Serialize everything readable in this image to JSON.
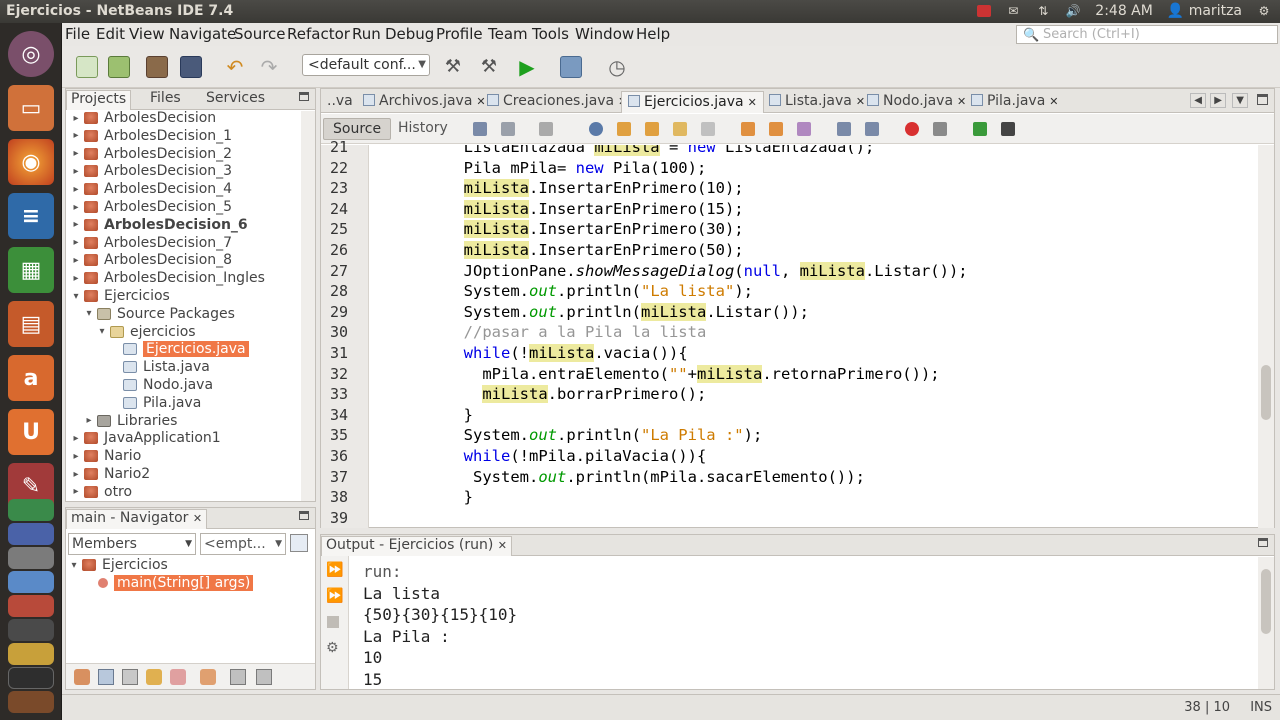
{
  "window": {
    "title": "Ejercicios - NetBeans IDE 7.4"
  },
  "tray": {
    "time": "2:48 AM",
    "user": "maritza"
  },
  "menu": [
    "File",
    "Edit",
    "View",
    "Navigate",
    "Source",
    "Refactor",
    "Run",
    "Debug",
    "Profile",
    "Team",
    "Tools",
    "Window",
    "Help"
  ],
  "search": {
    "placeholder": "Search (Ctrl+I)"
  },
  "toolbar": {
    "config": "<default conf..."
  },
  "projects_panel": {
    "tabs": [
      "Projects",
      "Files",
      "Services"
    ],
    "items": [
      {
        "label": "ArbolesDecision",
        "indent": 0,
        "type": "project",
        "tw": "▸"
      },
      {
        "label": "ArbolesDecision_1",
        "indent": 0,
        "type": "project",
        "tw": "▸"
      },
      {
        "label": "ArbolesDecision_2",
        "indent": 0,
        "type": "project",
        "tw": "▸"
      },
      {
        "label": "ArbolesDecision_3",
        "indent": 0,
        "type": "project",
        "tw": "▸"
      },
      {
        "label": "ArbolesDecision_4",
        "indent": 0,
        "type": "project",
        "tw": "▸"
      },
      {
        "label": "ArbolesDecision_5",
        "indent": 0,
        "type": "project",
        "tw": "▸"
      },
      {
        "label": "ArbolesDecision_6",
        "indent": 0,
        "type": "project",
        "tw": "▸",
        "bold": true
      },
      {
        "label": "ArbolesDecision_7",
        "indent": 0,
        "type": "project",
        "tw": "▸"
      },
      {
        "label": "ArbolesDecision_8",
        "indent": 0,
        "type": "project",
        "tw": "▸"
      },
      {
        "label": "ArbolesDecision_Ingles",
        "indent": 0,
        "type": "project",
        "tw": "▸"
      },
      {
        "label": "Ejercicios",
        "indent": 0,
        "type": "project",
        "tw": "▾"
      },
      {
        "label": "Source Packages",
        "indent": 1,
        "type": "src",
        "tw": "▾"
      },
      {
        "label": "ejercicios",
        "indent": 2,
        "type": "pkg",
        "tw": "▾"
      },
      {
        "label": "Ejercicios.java",
        "indent": 3,
        "type": "java",
        "tw": "",
        "selected": true
      },
      {
        "label": "Lista.java",
        "indent": 3,
        "type": "java",
        "tw": ""
      },
      {
        "label": "Nodo.java",
        "indent": 3,
        "type": "java",
        "tw": ""
      },
      {
        "label": "Pila.java",
        "indent": 3,
        "type": "java",
        "tw": ""
      },
      {
        "label": "Libraries",
        "indent": 1,
        "type": "lib",
        "tw": "▸"
      },
      {
        "label": "JavaApplication1",
        "indent": 0,
        "type": "project",
        "tw": "▸"
      },
      {
        "label": "Nario",
        "indent": 0,
        "type": "project",
        "tw": "▸"
      },
      {
        "label": "Nario2",
        "indent": 0,
        "type": "project",
        "tw": "▸"
      },
      {
        "label": "otro",
        "indent": 0,
        "type": "project",
        "tw": "▸"
      }
    ]
  },
  "navigator": {
    "title": "main - Navigator",
    "members_label": "Members",
    "filter_label": "<empt...",
    "class_name": "Ejercicios",
    "method": "main(String[] args)"
  },
  "editor": {
    "tabs": [
      {
        "label": "..va"
      },
      {
        "label": "Archivos.java"
      },
      {
        "label": "Creaciones.java"
      },
      {
        "label": "Ejercicios.java",
        "active": true
      },
      {
        "label": "Lista.java"
      },
      {
        "label": "Nodo.java"
      },
      {
        "label": "Pila.java"
      }
    ],
    "source_label": "Source",
    "history_label": "History",
    "line_numbers": [
      "21",
      "22",
      "23",
      "24",
      "25",
      "26",
      "27",
      "28",
      "29",
      "30",
      "31",
      "32",
      "33",
      "34",
      "35",
      "36",
      "37",
      "38",
      "39"
    ],
    "lines": [
      "        ListaEnlazada miLista = new ListaEnlazada();",
      "        Pila mPila= new Pila(100);",
      "        miLista.InsertarEnPrimero(10);",
      "        miLista.InsertarEnPrimero(15);",
      "        miLista.InsertarEnPrimero(30);",
      "        miLista.InsertarEnPrimero(50);",
      "        JOptionPane.showMessageDialog(null, miLista.Listar());",
      "        System.out.println(\"La lista\");",
      "        System.out.println(miLista.Listar());",
      "        //pasar a la Pila la lista",
      "        while(!miLista.vacia()){",
      "          mPila.entraElemento(\"\"+miLista.retornaPrimero());",
      "          miLista.borrarPrimero();",
      "        }",
      "        System.out.println(\"La Pila :\");",
      "        while(!mPila.pilaVacia()){",
      "         System.out.println(mPila.sacarElemento());",
      "        }",
      ""
    ]
  },
  "output": {
    "title": "Output - Ejercicios (run)",
    "lines": [
      "run:",
      "La lista",
      "{50}{30}{15}{10}",
      "La Pila :",
      "10",
      "15"
    ]
  },
  "status": {
    "position": "38 | 10",
    "mode": "INS"
  }
}
